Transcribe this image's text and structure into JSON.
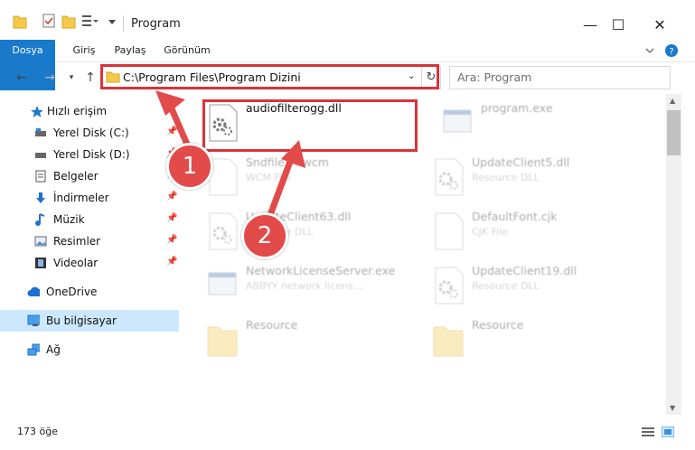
{
  "window": {
    "title": "Program",
    "controls": {
      "minimize": "—",
      "maximize": "☐",
      "close": "✕"
    }
  },
  "ribbon": {
    "tabs": [
      "Dosya",
      "Giriş",
      "Paylaş",
      "Görünüm"
    ]
  },
  "address": {
    "path": "C:\\Program Files\\Program Dizini",
    "search_placeholder": "Ara: Program"
  },
  "nav": {
    "items": [
      {
        "label": "Hızlı erişim",
        "icon": "star-icon",
        "pinned": false
      },
      {
        "label": "Yerel Disk (C:)",
        "icon": "drive-icon",
        "pinned": true
      },
      {
        "label": "Yerel Disk (D:)",
        "icon": "drive-icon",
        "pinned": true
      },
      {
        "label": "Belgeler",
        "icon": "document-icon",
        "pinned": true
      },
      {
        "label": "İndirmeler",
        "icon": "download-icon",
        "pinned": true
      },
      {
        "label": "Müzik",
        "icon": "music-icon",
        "pinned": true
      },
      {
        "label": "Resimler",
        "icon": "pictures-icon",
        "pinned": true
      },
      {
        "label": "Videolar",
        "icon": "video-icon",
        "pinned": true
      },
      {
        "label": "OneDrive",
        "icon": "cloud-icon",
        "pinned": false
      },
      {
        "label": "Bu bilgisayar",
        "icon": "computer-icon",
        "pinned": false
      },
      {
        "label": "Ağ",
        "icon": "network-icon",
        "pinned": false
      }
    ]
  },
  "files": [
    {
      "name": "audiofilterogg.dll",
      "type": "",
      "icon": "dll-gear-icon"
    },
    {
      "name": "program.exe",
      "type": "",
      "icon": "exe-icon"
    },
    {
      "name": "Sndfile74.wcm",
      "type": "WCM File",
      "icon": "blank-file-icon"
    },
    {
      "name": "UpdateClient5.dll",
      "type": "Resource DLL",
      "icon": "dll-gear-icon"
    },
    {
      "name": "UpdateClient63.dll",
      "type": "Resource DLL",
      "icon": "dll-gear-icon"
    },
    {
      "name": "DefaultFont.cjk",
      "type": "CJK File",
      "icon": "blank-file-icon"
    },
    {
      "name": "NetworkLicenseServer.exe",
      "type": "ABBYY network licens...",
      "icon": "exe-icon"
    },
    {
      "name": "UpdateClient19.dll",
      "type": "Resource DLL",
      "icon": "dll-gear-icon"
    },
    {
      "name": "Resource",
      "type": "",
      "icon": "folder-icon"
    },
    {
      "name": "Resource",
      "type": "",
      "icon": "folder-icon"
    }
  ],
  "status": {
    "item_count": "173 öğe"
  },
  "annotations": {
    "step1": "1",
    "step2": "2"
  },
  "colors": {
    "accent": "#1979ca",
    "highlight": "#d9333a",
    "badge": "#e34a4a",
    "selected_nav": "#cce8ff"
  }
}
